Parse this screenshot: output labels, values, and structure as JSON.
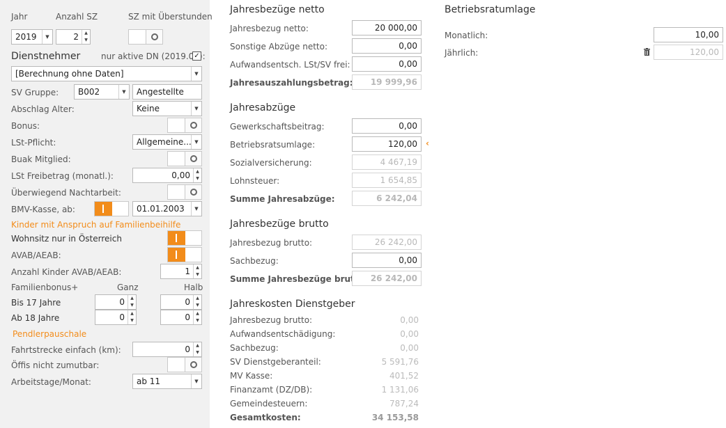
{
  "left": {
    "hdr_year": "Jahr",
    "hdr_anzahl": "Anzahl SZ",
    "hdr_sz": "SZ mit Überstunden",
    "year": "2019",
    "anzahl": "2",
    "dn_title": "Dienstnehmer",
    "active_label": "nur aktive DN (2019.01):",
    "active_checked": "✓",
    "dn_select": "[Berechnung ohne Daten]",
    "sv_label": "SV Gruppe:",
    "sv_code": "B002",
    "sv_name": "Angestellte",
    "abschlag_label": "Abschlag Alter:",
    "abschlag_value": "Keine",
    "bonus_label": "Bonus:",
    "lst_label": "LSt-Pflicht:",
    "lst_value": "Allgemeine...",
    "buak_label": "Buak Mitglied:",
    "freibetrag_label": "LSt Freibetrag (monatl.):",
    "freibetrag_value": "0,00",
    "nacht_label": "Überwiegend Nachtarbeit:",
    "bmv_label": "BMV-Kasse, ab:",
    "bmv_date": "01.01.2003",
    "kinder_title": "Kinder mit Anspruch auf Familienbeihilfe",
    "wohnsitz_label": "Wohnsitz nur in Österreich",
    "avab_label": "AVAB/AEAB:",
    "anzahl_kinder_label": "Anzahl Kinder AVAB/AEAB:",
    "anzahl_kinder_value": "1",
    "fb_label": "Familienbonus+",
    "ganz_label": "Ganz",
    "halb_label": "Halb",
    "bis17_label": "Bis 17 Jahre",
    "bis17_ganz": "0",
    "bis17_halb": "0",
    "ab18_label": "Ab 18 Jahre",
    "ab18_ganz": "0",
    "ab18_halb": "0",
    "pendler_title": "Pendlerpauschale",
    "fahrt_label": "Fahrtstrecke einfach (km):",
    "fahrt_value": "0",
    "oeffis_label": "Öffis nicht zumutbar:",
    "arbeitstage_label": "Arbeitstage/Monat:",
    "arbeitstage_value": "ab 11"
  },
  "netto": {
    "title": "Jahresbezüge netto",
    "rows": [
      {
        "label": "Jahresbezug netto:",
        "value": "20 000,00"
      },
      {
        "label": "Sonstige Abzüge netto:",
        "value": "0,00"
      },
      {
        "label": "Aufwandsentsch. LSt/SV frei:",
        "value": "0,00"
      }
    ],
    "total_label": "Jahresauszahlungsbetrag:",
    "total_value": "19 999,96"
  },
  "abzuege": {
    "title": "Jahresabzüge",
    "rows": [
      {
        "label": "Gewerkschaftsbeitrag:",
        "value": "0,00"
      },
      {
        "label": "Betriebsratsumlage:",
        "value": "120,00"
      },
      {
        "label": "Sozialversicherung:",
        "value": "4 467,19"
      },
      {
        "label": "Lohnsteuer:",
        "value": "1 654,85"
      }
    ],
    "total_label": "Summe Jahresabzüge:",
    "total_value": "6 242,04"
  },
  "brutto": {
    "title": "Jahresbezüge brutto",
    "rows": [
      {
        "label": "Jahresbezug brutto:",
        "value": "26 242,00"
      },
      {
        "label": "Sachbezug:",
        "value": "0,00"
      }
    ],
    "total_label": "Summe Jahresbezüge brutto:",
    "total_value": "26 242,00"
  },
  "kosten": {
    "title": "Jahreskosten Dienstgeber",
    "rows": [
      {
        "label": "Jahresbezug brutto:",
        "value": "0,00"
      },
      {
        "label": "Aufwandsentschädigung:",
        "value": "0,00"
      },
      {
        "label": "Sachbezug:",
        "value": "0,00"
      },
      {
        "label": "SV Dienstgeberanteil:",
        "value": "5 591,76"
      },
      {
        "label": "MV Kasse:",
        "value": "401,52"
      },
      {
        "label": "Finanzamt (DZ/DB):",
        "value": "1 131,06"
      },
      {
        "label": "Gemeindesteuern:",
        "value": "787,24"
      }
    ],
    "total_label": "Gesamtkosten:",
    "total_value": "34 153,58"
  },
  "br": {
    "title": "Betriebsratumlage",
    "monat_label": "Monatlich:",
    "monat_value": "10,00",
    "jahr_label": "Jährlich:",
    "jahr_value": "120,00"
  },
  "colors": {
    "accent": "#f28c1a",
    "panel": "#f1f1f1"
  },
  "icons": {
    "marker": "chevron-left-icon",
    "delete": "trash-icon"
  }
}
